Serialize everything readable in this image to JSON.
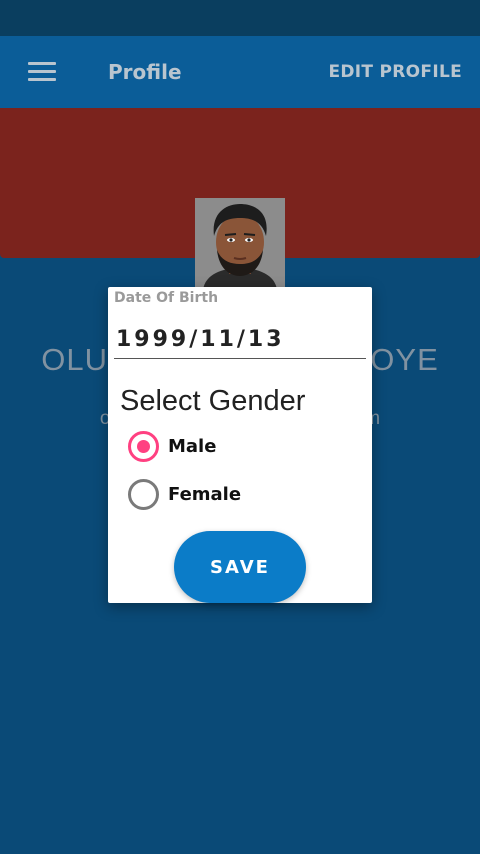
{
  "toolbar": {
    "menu_icon": "hamburger-menu-icon",
    "title": "Profile",
    "action": "EDIT PROFILE"
  },
  "profile": {
    "name": "OLUWASEGUN ADEBOYE",
    "email": "oluwasegunadeboye@gmail.com",
    "avatar": "profile-photo"
  },
  "dialog": {
    "dob_label": "Date Of Birth",
    "dob_value": "1999/11/13",
    "gender_title": "Select Gender",
    "options": [
      {
        "label": "Male",
        "selected": true
      },
      {
        "label": "Female",
        "selected": false
      }
    ],
    "save_label": "SAVE"
  },
  "colors": {
    "status_bar": "#0a3e5f",
    "toolbar": "#0b5d98",
    "cover": "#7b231d",
    "background": "#0a4a77",
    "accent": "#ff4081",
    "button": "#0b7cc8"
  }
}
